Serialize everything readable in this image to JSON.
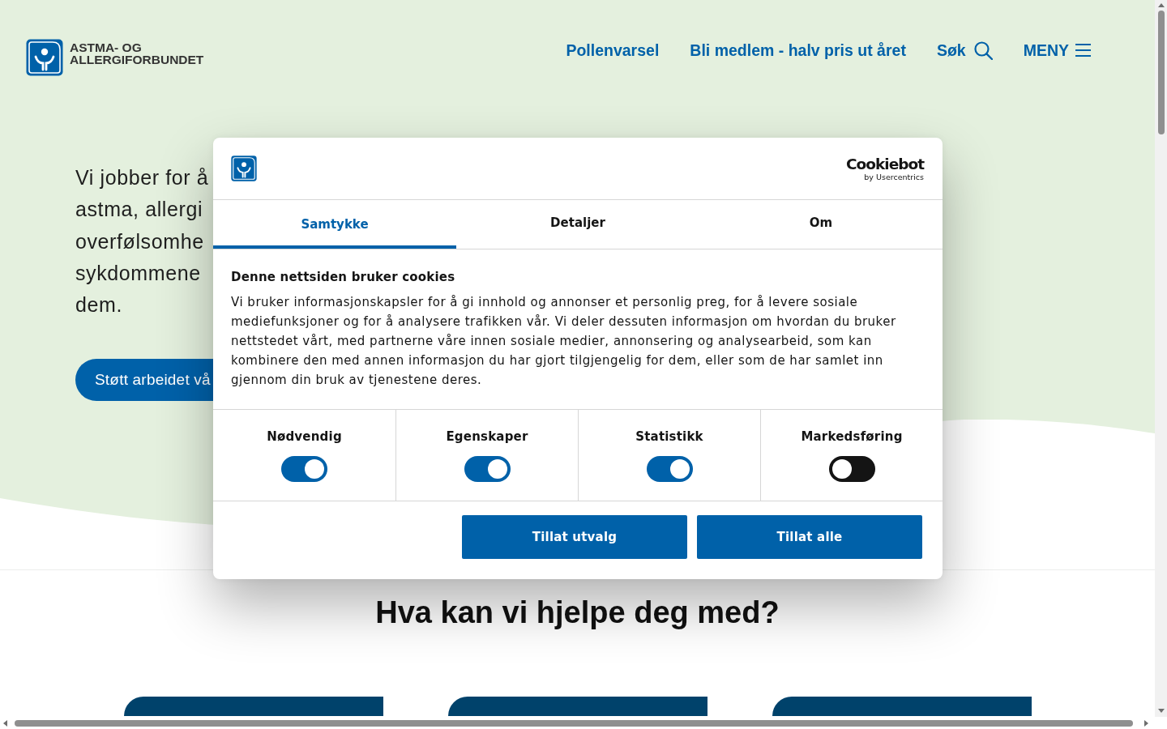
{
  "header": {
    "logo": {
      "line_1": "ASTMA- OG",
      "line_2": "ALLERGIFORBUNDET"
    },
    "nav": [
      {
        "kind": "link",
        "label": "Pollenvarsel"
      },
      {
        "kind": "link",
        "label": "Bli medlem - halv pris ut året"
      },
      {
        "kind": "search",
        "label": "Søk"
      },
      {
        "kind": "menu",
        "label": "MENY"
      }
    ]
  },
  "hero": {
    "text_lines": [
      "Vi jobber for å",
      "astma, allergi",
      "overfølsomhe",
      "sykdommene",
      "dem."
    ],
    "button": "Støtt arbeidet vå"
  },
  "help_section": {
    "heading": "Hva kan vi hjelpe deg med?"
  },
  "cookie_dialog": {
    "brand": {
      "name": "Cookiebot",
      "byline": "by Usercentrics"
    },
    "tabs": [
      {
        "label": "Samtykke",
        "selected": true
      },
      {
        "label": "Detaljer",
        "selected": false
      },
      {
        "label": "Om",
        "selected": false
      }
    ],
    "title": "Denne nettsiden bruker cookies",
    "text": "Vi bruker informasjonskapsler for å gi innhold og annonser et personlig preg, for å levere sosiale mediefunksjoner og for å analysere trafikken vår. Vi deler dessuten informasjon om hvordan du bruker nettstedet vårt, med partnerne våre innen sosiale medier, annonsering og analysearbeid, som kan kombinere den med annen informasjon du har gjort tilgjengelig for dem, eller som de har samlet inn gjennom din bruk av tjenestene deres.",
    "toggles": [
      {
        "label": "Nødvendig",
        "on": true
      },
      {
        "label": "Egenskaper",
        "on": true
      },
      {
        "label": "Statistikk",
        "on": true
      },
      {
        "label": "Markedsføring",
        "on": false
      }
    ],
    "buttons": [
      "Tillat utvalg",
      "Tillat alle"
    ]
  }
}
